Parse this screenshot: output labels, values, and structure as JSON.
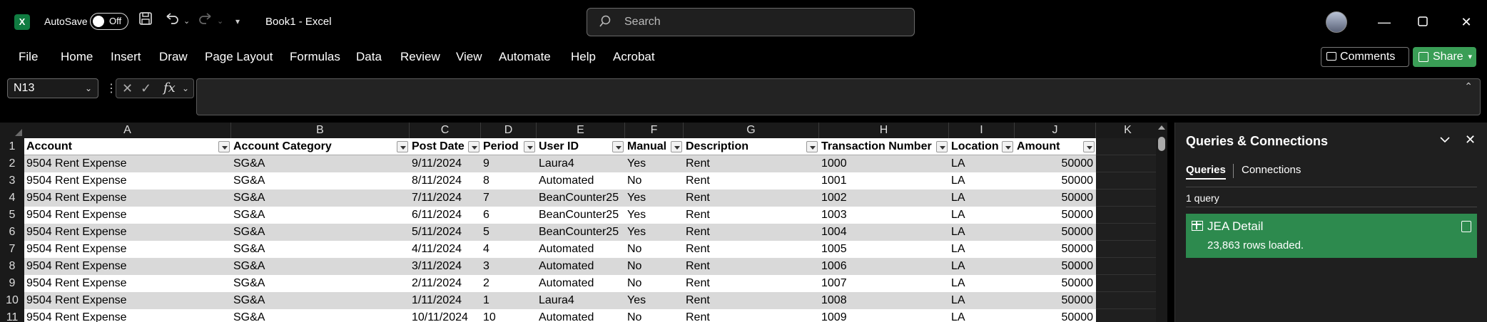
{
  "titlebar": {
    "autosave_label": "AutoSave",
    "autosave_state": "Off",
    "doc_title": "Book1  -  Excel",
    "search_placeholder": "Search"
  },
  "ribbon": {
    "tabs": [
      "File",
      "Home",
      "Insert",
      "Draw",
      "Page Layout",
      "Formulas",
      "Data",
      "Review",
      "View",
      "Automate",
      "Help",
      "Acrobat"
    ],
    "comments_label": "Comments",
    "share_label": "Share"
  },
  "formula_bar": {
    "name_box": "N13",
    "fx_label": "fx",
    "formula": ""
  },
  "sheet": {
    "column_letters": [
      "A",
      "B",
      "C",
      "D",
      "E",
      "F",
      "G",
      "H",
      "I",
      "J",
      "K"
    ],
    "headers": [
      "Account",
      "Account Category",
      "Post Date",
      "Period",
      "User ID",
      "Manual",
      "Description",
      "Transaction Number",
      "Location",
      "Amount"
    ],
    "row_numbers": [
      "1",
      "2",
      "3",
      "4",
      "5",
      "6",
      "7",
      "8",
      "9",
      "10",
      "11"
    ],
    "rows": [
      [
        "9504 Rent Expense",
        "SG&A",
        "9/11/2024",
        "9",
        "Laura4",
        "Yes",
        "Rent",
        "1000",
        "LA",
        "50000"
      ],
      [
        "9504 Rent Expense",
        "SG&A",
        "8/11/2024",
        "8",
        "Automated",
        "No",
        "Rent",
        "1001",
        "LA",
        "50000"
      ],
      [
        "9504 Rent Expense",
        "SG&A",
        "7/11/2024",
        "7",
        "BeanCounter25",
        "Yes",
        "Rent",
        "1002",
        "LA",
        "50000"
      ],
      [
        "9504 Rent Expense",
        "SG&A",
        "6/11/2024",
        "6",
        "BeanCounter25",
        "Yes",
        "Rent",
        "1003",
        "LA",
        "50000"
      ],
      [
        "9504 Rent Expense",
        "SG&A",
        "5/11/2024",
        "5",
        "BeanCounter25",
        "Yes",
        "Rent",
        "1004",
        "LA",
        "50000"
      ],
      [
        "9504 Rent Expense",
        "SG&A",
        "4/11/2024",
        "4",
        "Automated",
        "No",
        "Rent",
        "1005",
        "LA",
        "50000"
      ],
      [
        "9504 Rent Expense",
        "SG&A",
        "3/11/2024",
        "3",
        "Automated",
        "No",
        "Rent",
        "1006",
        "LA",
        "50000"
      ],
      [
        "9504 Rent Expense",
        "SG&A",
        "2/11/2024",
        "2",
        "Automated",
        "No",
        "Rent",
        "1007",
        "LA",
        "50000"
      ],
      [
        "9504 Rent Expense",
        "SG&A",
        "1/11/2024",
        "1",
        "Laura4",
        "Yes",
        "Rent",
        "1008",
        "LA",
        "50000"
      ],
      [
        "9504 Rent Expense",
        "SG&A",
        "10/11/2024",
        "10",
        "Automated",
        "No",
        "Rent",
        "1009",
        "LA",
        "50000"
      ]
    ],
    "band_color": "#d9d9d9",
    "white_color": "#ffffff"
  },
  "queries_pane": {
    "title": "Queries & Connections",
    "tab_queries": "Queries",
    "tab_connections": "Connections",
    "query_count": "1 query",
    "query_name": "JEA Detail",
    "query_rows": "23,863 rows loaded.",
    "card_color": "#2d8a4e"
  },
  "accent_green": "#107c41"
}
